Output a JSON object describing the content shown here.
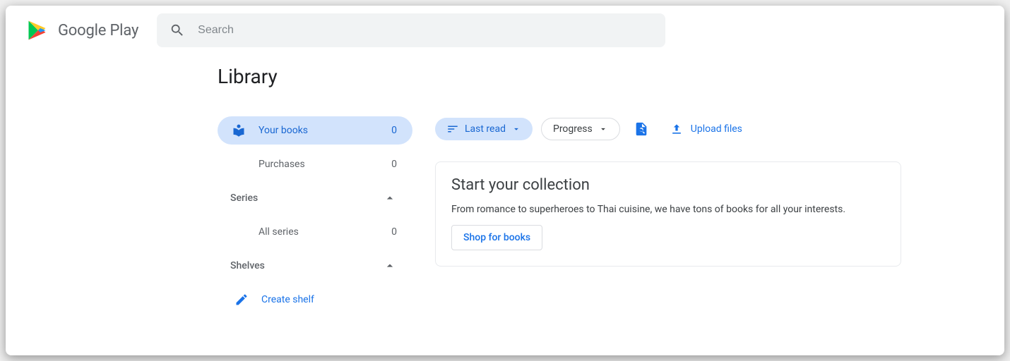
{
  "brand": {
    "name": "Google Play"
  },
  "search": {
    "placeholder": "Search"
  },
  "page": {
    "title": "Library"
  },
  "sidebar": {
    "your_books": {
      "label": "Your books",
      "count": "0"
    },
    "purchases": {
      "label": "Purchases",
      "count": "0"
    },
    "series": {
      "label": "Series"
    },
    "all_series": {
      "label": "All series",
      "count": "0"
    },
    "shelves": {
      "label": "Shelves"
    },
    "create_shelf": {
      "label": "Create shelf"
    }
  },
  "toolbar": {
    "sort": "Last read",
    "progress": "Progress",
    "upload": "Upload files"
  },
  "card": {
    "title": "Start your collection",
    "body": "From romance to superheroes to Thai cuisine, we have tons of books for all your interests.",
    "button": "Shop for books"
  }
}
